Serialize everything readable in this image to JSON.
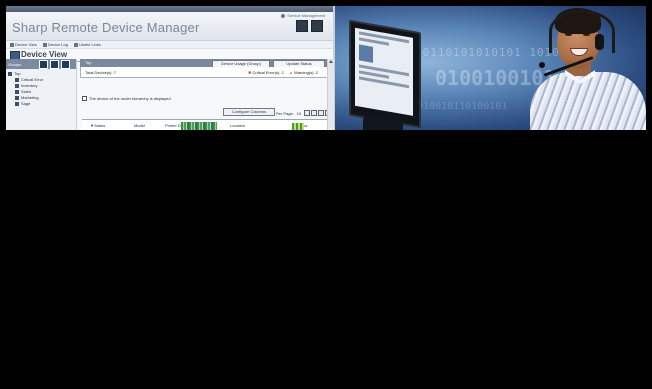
{
  "app": {
    "title": "Sharp Remote Device Manager",
    "service_management": "Service Management",
    "menu": [
      "Device View",
      "Device Log",
      "Useful Links"
    ],
    "view_title": "Device View",
    "sidebar": {
      "groups_label": "Groups",
      "tree": [
        {
          "label": "Top",
          "level": 0
        },
        {
          "label": "Critical Error",
          "level": 1
        },
        {
          "label": "Inventory",
          "level": 1
        },
        {
          "label": "Sales",
          "level": 1
        },
        {
          "label": "Marketing",
          "level": 1
        },
        {
          "label": "Sage",
          "level": 1
        }
      ]
    },
    "main": {
      "bar_label": "Top",
      "device_usage_button": "Device Usage (Group)",
      "update_status_button": "Update Status",
      "total_devices": "Total Device(s): 7",
      "critical_errors": "Critical Error(s): 2",
      "warnings": "Warning(s): 2",
      "hierarchy_note": "The device of the under hierarchy is displayed.",
      "configure_columns": "Configure Columns",
      "per_page_label": "Per Page:",
      "per_page_value": "10",
      "columns": [
        "Status",
        "Model",
        "Printer Driver",
        "Location",
        "Status"
      ]
    }
  },
  "photo": {
    "binary_line1": "10110101010101 1010",
    "binary_line2": "0100100101",
    "binary_line3": "01010010110100101"
  },
  "colors": {
    "background": "#000000",
    "header_bar": "#7b899f",
    "critical": "#c82020",
    "warning": "#d08a10"
  }
}
